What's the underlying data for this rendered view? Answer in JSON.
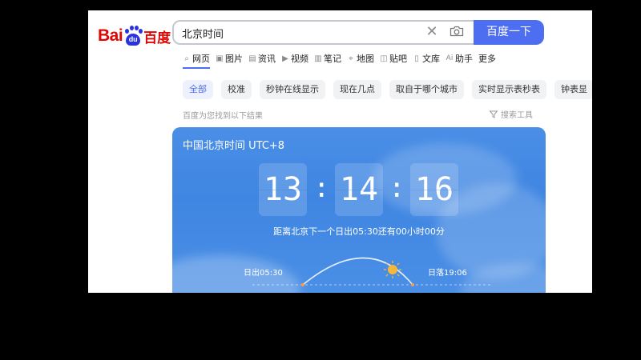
{
  "logo": {
    "latin": "Bai",
    "paw_text": "du",
    "cn": "百度"
  },
  "search": {
    "value": "北京时间",
    "button_label": "百度一下"
  },
  "tabs": [
    {
      "icon": "search-icon",
      "label": "网页"
    },
    {
      "icon": "image-icon",
      "label": "图片"
    },
    {
      "icon": "news-icon",
      "label": "资讯"
    },
    {
      "icon": "video-icon",
      "label": "视频"
    },
    {
      "icon": "note-icon",
      "label": "笔记"
    },
    {
      "icon": "map-icon",
      "label": "地图"
    },
    {
      "icon": "tieba-icon",
      "label": "贴吧"
    },
    {
      "icon": "wenku-icon",
      "label": "文库"
    },
    {
      "icon": "ai-icon",
      "label": "助手"
    },
    {
      "icon": "",
      "label": "更多"
    }
  ],
  "chips": [
    "全部",
    "校准",
    "秒钟在线显示",
    "现在几点",
    "取自于哪个城市",
    "实时显示表秒表",
    "钟表显"
  ],
  "result_info": "百度为您找到以下结果",
  "tools_label": "搜索工具",
  "card": {
    "title": "中国北京时间 UTC+8",
    "time": {
      "hour": "13",
      "minute": "14",
      "second": "16"
    },
    "separator": ":",
    "countdown": "距离北京下一个日出05:30还有00小时00分",
    "sunrise": "日出05:30",
    "sunset": "日落19:06"
  },
  "colors": {
    "accent": "#4e6ef2",
    "logo_red": "#e10602",
    "logo_blue": "#2932e1",
    "card_blue": "#4a8ee6",
    "sun": "#f5b73b"
  }
}
